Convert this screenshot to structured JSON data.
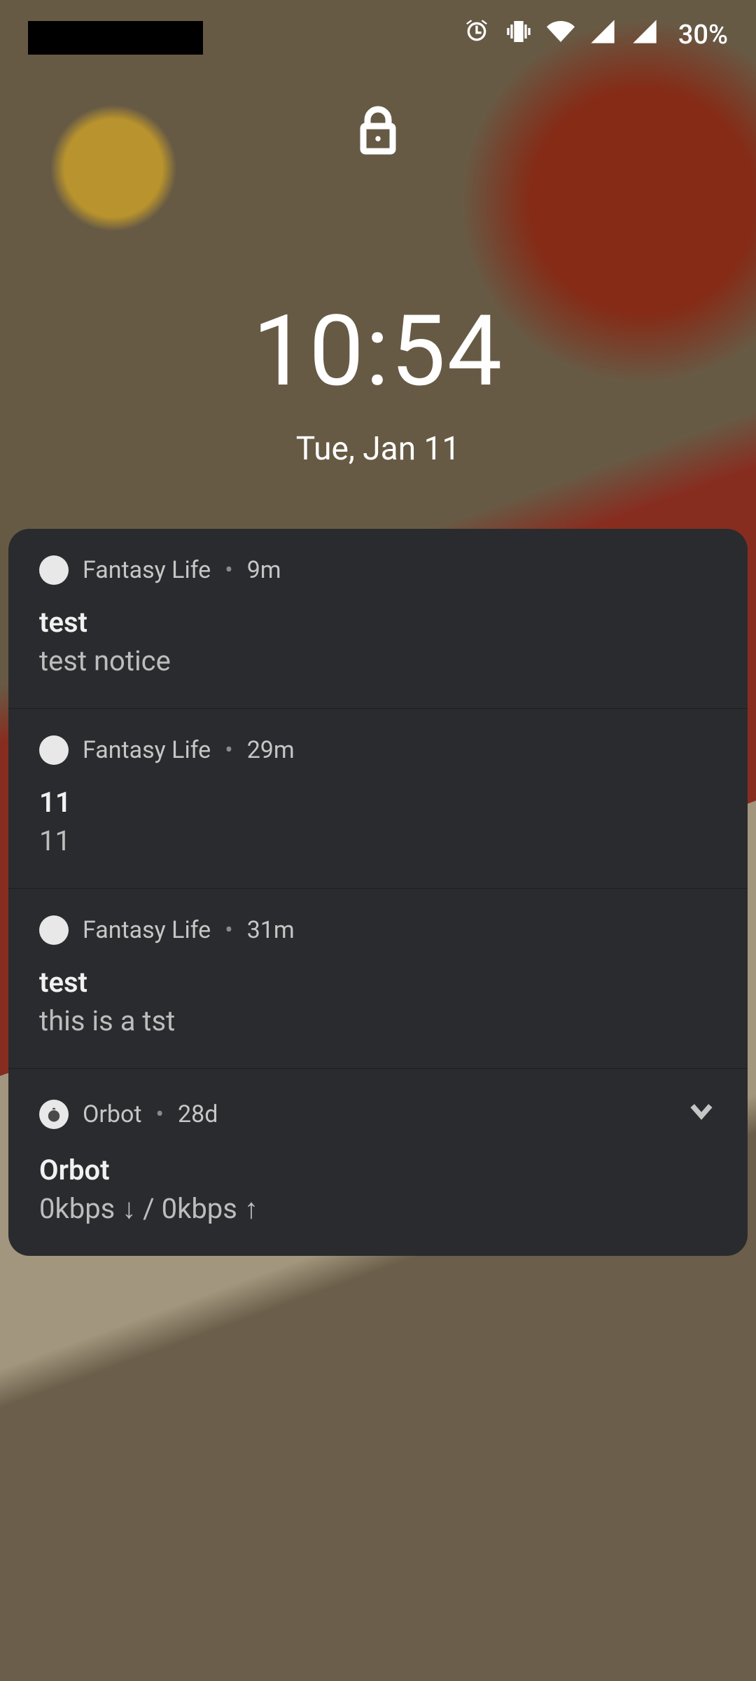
{
  "statusbar": {
    "battery_percent": "30%"
  },
  "clock": {
    "time": "10:54",
    "date": "Tue, Jan 11"
  },
  "notifications": [
    {
      "app": "Fantasy Life",
      "age": "9m",
      "title": "test",
      "body": "test notice",
      "icon": "generic",
      "expandable": false
    },
    {
      "app": "Fantasy Life",
      "age": "29m",
      "title": "11",
      "body": "11",
      "icon": "generic",
      "expandable": false
    },
    {
      "app": "Fantasy Life",
      "age": "31m",
      "title": "test",
      "body": "this is a tst",
      "icon": "generic",
      "expandable": false
    },
    {
      "app": "Orbot",
      "age": "28d",
      "title": "Orbot",
      "body": "0kbps ↓ / 0kbps ↑",
      "icon": "orbot",
      "expandable": true
    }
  ]
}
